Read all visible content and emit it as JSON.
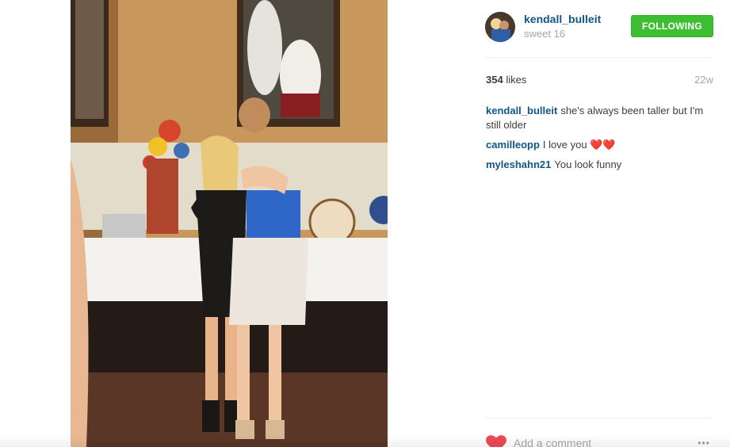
{
  "post": {
    "photo_icon": "photo-image",
    "owner": {
      "username": "kendall_bulleit",
      "location": "sweet 16",
      "avatar_icon": "profile-avatar"
    },
    "follow_button": {
      "label": "FOLLOWING",
      "color": "#3ebf33"
    },
    "likes": {
      "count": "354",
      "label": " likes"
    },
    "timestamp": "22w",
    "comments": [
      {
        "author": "kendall_bulleit",
        "text": "she's always been taller but I'm still older"
      },
      {
        "author": "camilleopp",
        "text": "I love you",
        "emoji": "❤️❤️"
      },
      {
        "author": "myleshahn21",
        "text": "You look funny"
      }
    ],
    "add_comment": {
      "placeholder": "Add a comment"
    },
    "more_label": "•••",
    "colors": {
      "link": "#125688",
      "heart": "#ed4956",
      "muted": "#a5a7aa"
    }
  }
}
